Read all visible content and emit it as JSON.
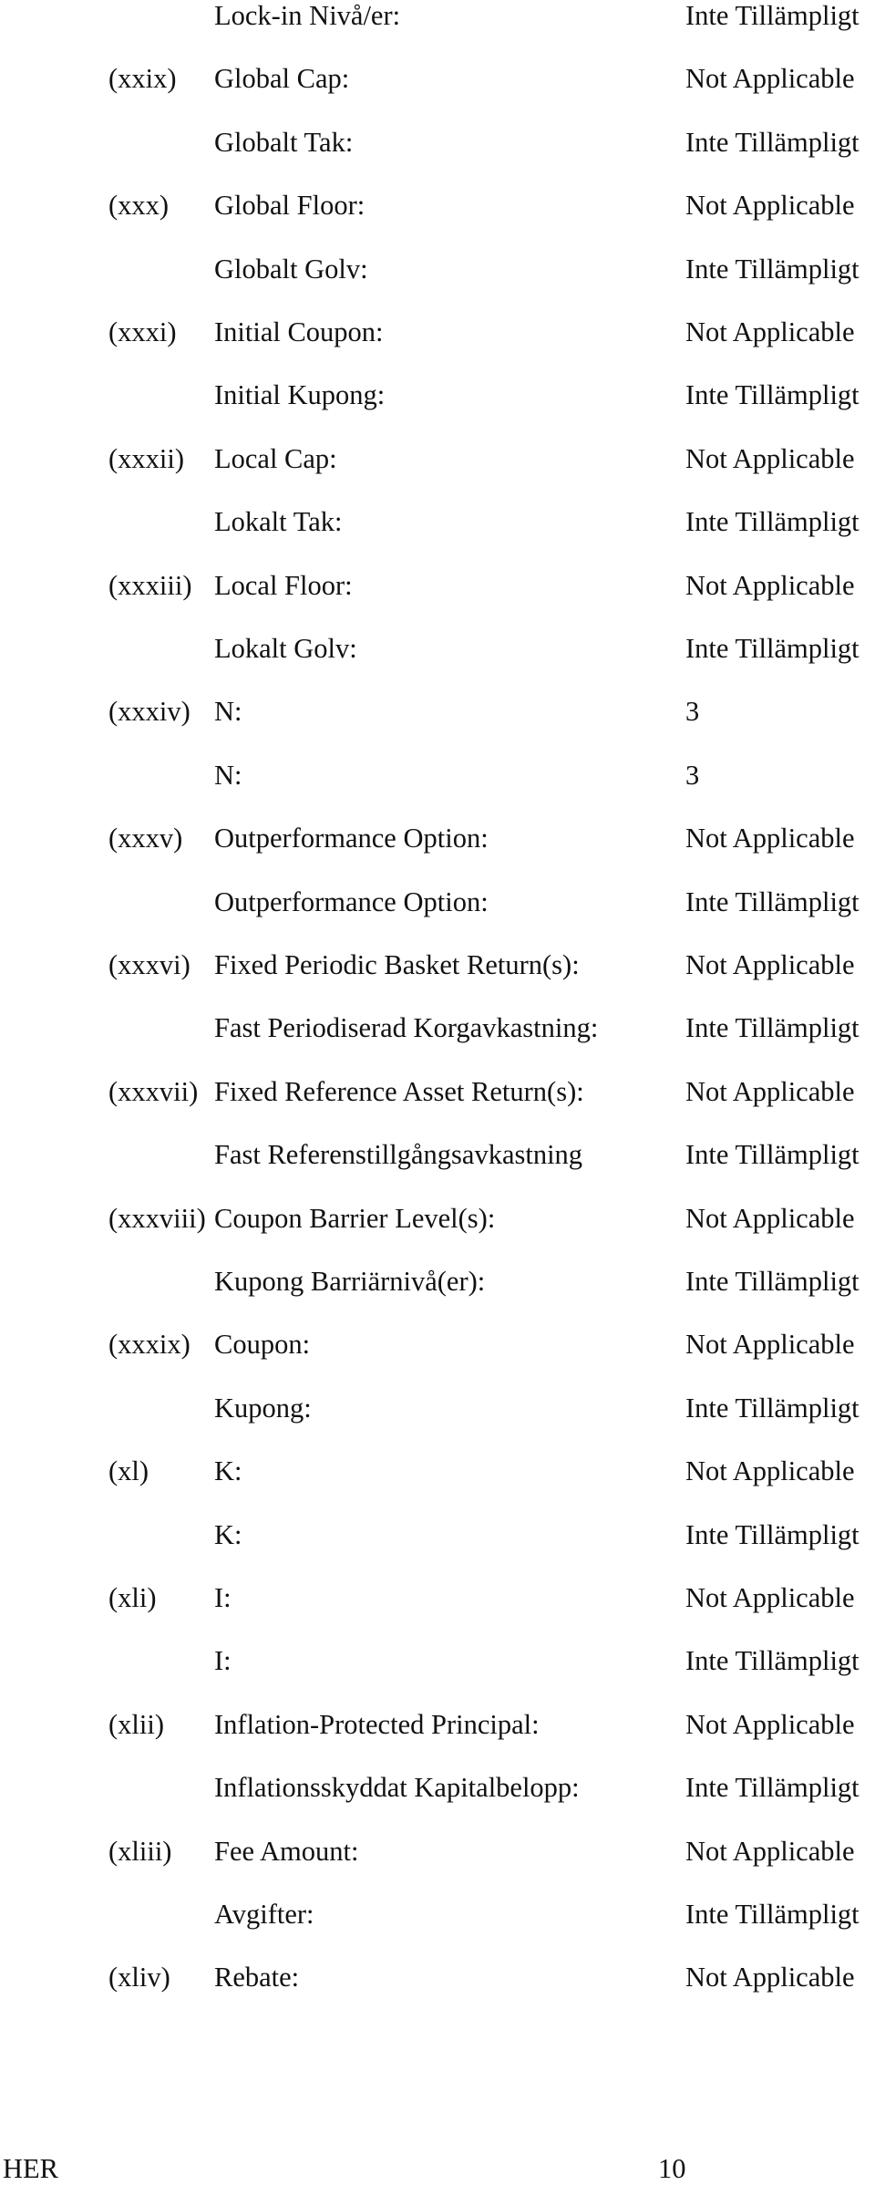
{
  "document": {
    "rows": [
      {
        "num": "",
        "label": "Lock-in Nivå/er:",
        "value": "Inte Tillämpligt"
      },
      {
        "num": "(xxix)",
        "label": "Global Cap:",
        "value": "Not Applicable"
      },
      {
        "num": "",
        "label": "Globalt Tak:",
        "value": "Inte Tillämpligt"
      },
      {
        "num": "(xxx)",
        "label": "Global Floor:",
        "value": "Not Applicable"
      },
      {
        "num": "",
        "label": "Globalt Golv:",
        "value": "Inte Tillämpligt"
      },
      {
        "num": "(xxxi)",
        "label": "Initial Coupon:",
        "value": "Not Applicable"
      },
      {
        "num": "",
        "label": "Initial Kupong:",
        "value": "Inte Tillämpligt"
      },
      {
        "num": "(xxxii)",
        "label": "Local Cap:",
        "value": "Not Applicable"
      },
      {
        "num": "",
        "label": "Lokalt Tak:",
        "value": "Inte Tillämpligt"
      },
      {
        "num": "(xxxiii)",
        "label": "Local Floor:",
        "value": "Not Applicable"
      },
      {
        "num": "",
        "label": "Lokalt Golv:",
        "value": "Inte Tillämpligt"
      },
      {
        "num": "(xxxiv)",
        "label": "N:",
        "value": "3"
      },
      {
        "num": "",
        "label": "N:",
        "value": "3"
      },
      {
        "num": "(xxxv)",
        "label": "Outperformance Option:",
        "value": "Not Applicable"
      },
      {
        "num": "",
        "label": "Outperformance Option:",
        "value": "Inte Tillämpligt"
      },
      {
        "num": "(xxxvi)",
        "label": "Fixed Periodic Basket Return(s):",
        "value": "Not Applicable"
      },
      {
        "num": "",
        "label": "Fast Periodiserad Korgavkastning:",
        "value": "Inte Tillämpligt"
      },
      {
        "num": "(xxxvii)",
        "label": "Fixed Reference Asset Return(s):",
        "value": "Not Applicable"
      },
      {
        "num": "",
        "label": "Fast Referenstillgångsavkastning",
        "value": "Inte Tillämpligt"
      },
      {
        "num": "(xxxviii)",
        "label": "Coupon Barrier Level(s):",
        "value": "Not Applicable"
      },
      {
        "num": "",
        "label": "Kupong Barriärnivå(er):",
        "value": "Inte Tillämpligt"
      },
      {
        "num": "(xxxix)",
        "label": "Coupon:",
        "value": "Not Applicable"
      },
      {
        "num": "",
        "label": "Kupong:",
        "value": "Inte Tillämpligt"
      },
      {
        "num": "(xl)",
        "label": "K:",
        "value": "Not Applicable"
      },
      {
        "num": "",
        "label": "K:",
        "value": "Inte Tillämpligt"
      },
      {
        "num": "(xli)",
        "label": "I:",
        "value": "Not Applicable"
      },
      {
        "num": "",
        "label": "I:",
        "value": "Inte Tillämpligt"
      },
      {
        "num": "(xlii)",
        "label": "Inflation-Protected Principal:",
        "value": "Not Applicable"
      },
      {
        "num": "",
        "label": "Inflationsskyddat Kapitalbelopp:",
        "value": "Inte Tillämpligt"
      },
      {
        "num": "(xliii)",
        "label": "Fee Amount:",
        "value": "Not Applicable"
      },
      {
        "num": "",
        "label": "Avgifter:",
        "value": "Inte Tillämpligt"
      },
      {
        "num": "(xliv)",
        "label": "Rebate:",
        "value": "Not Applicable"
      }
    ]
  },
  "footer": {
    "left": "HER",
    "page_number": "10"
  }
}
